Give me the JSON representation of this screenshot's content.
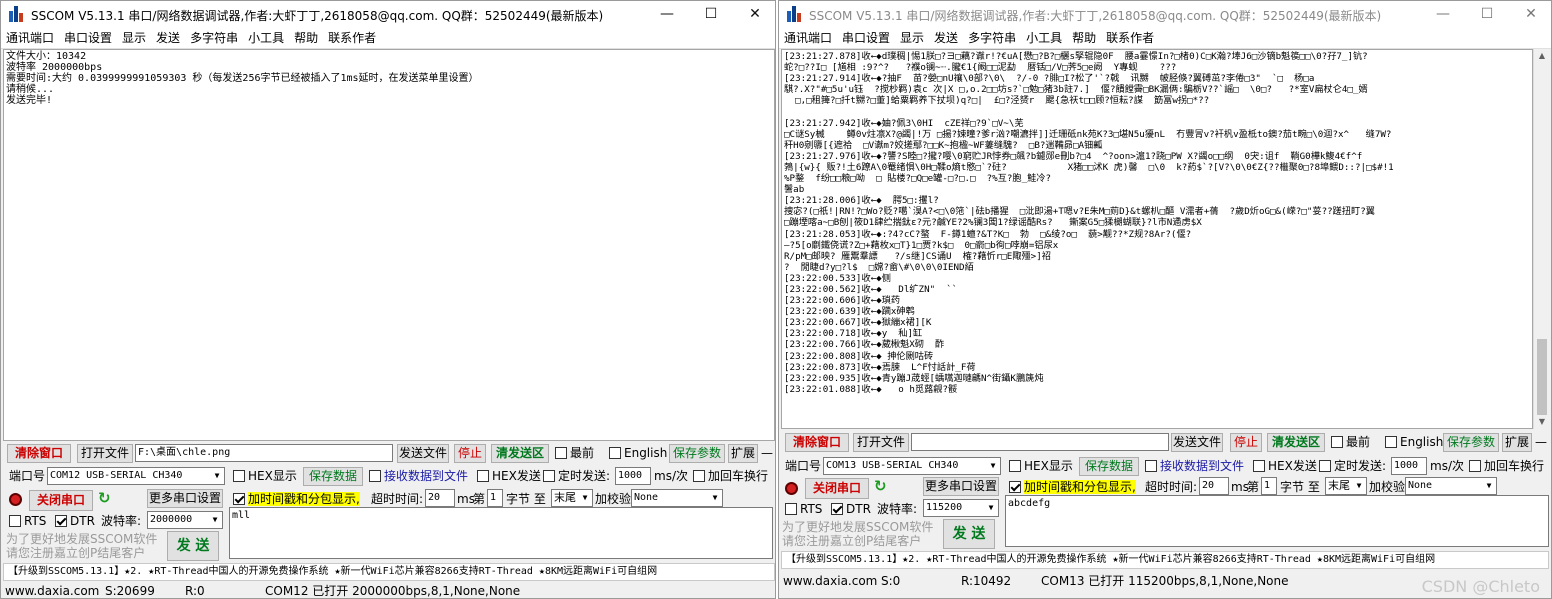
{
  "left": {
    "title": "SSCOM V5.13.1 串口/网络数据调试器,作者:大虾丁丁,2618058@qq.com. QQ群：52502449(最新版本)",
    "menu": [
      "通讯端口",
      "串口设置",
      "显示",
      "发送",
      "多字符串",
      "小工具",
      "帮助",
      "联系作者"
    ],
    "receive_lines": [
      "文件大小：10342",
      "波特率 2000000bps",
      "需要时间:大约 0.0399999991059303 秒（每发送256字节已经被插入了1ms延时，在发送菜单里设置）",
      "请稍候...",
      "发送完毕!"
    ],
    "clear_window": "清除窗口",
    "open_file": "打开文件",
    "file_path": "F:\\桌面\\chle.png",
    "send_file": "发送文件",
    "stop": "停止",
    "clear_send": "清发送区",
    "topmost": "最前",
    "english": "English",
    "save_params": "保存参数",
    "expand": "扩展",
    "expand_minus": "—",
    "port_label": "端口号",
    "port_value": "COM12 USB-SERIAL CH340",
    "hex_display": "HEX显示",
    "save_data": "保存数据",
    "recv_to_file": "接收数据到文件",
    "hex_send": "HEX发送",
    "timed_send": "定时发送:",
    "interval": "1000",
    "interval_unit": "ms/次",
    "add_crlf": "加回车换行",
    "close_port": "关闭串口",
    "more_settings": "更多串口设置",
    "timestamp_pkt": "加时间戳和分包显示,",
    "timeout_label": "超时时间:",
    "timeout": "20",
    "ms": "ms",
    "nth": "第",
    "byte_from": "1",
    "byte_to_label": "字节 至",
    "tail": "末尾",
    "checksum_label": "加校验",
    "checksum": "None",
    "rts": "RTS",
    "dtr": "DTR",
    "baud_label": "波特率:",
    "baud": "2000000",
    "send_text": "mll",
    "promo_1": "为了更好地发展SSCOM软件",
    "promo_2": "请您注册嘉立创P结尾客户",
    "send_btn": "发 送",
    "news": "【升级到SSCOM5.13.1】★2. ★RT-Thread中国人的开源免费操作系统 ★新一代WiFi芯片兼容8266支持RT-Thread ★8KM远距离WiFi可自组网",
    "status_site": "www.daxia.com",
    "status_s": "S:20699",
    "status_r": "R:0",
    "status_port": "COM12 已打开  2000000bps,8,1,None,None"
  },
  "right": {
    "title": "SSCOM V5.13.1 串口/网络数据调试器,作者:大虾丁丁,2618058@qq.com. QQ群：52502449(最新版本)",
    "menu": [
      "通讯端口",
      "串口设置",
      "显示",
      "发送",
      "多字符串",
      "小工具",
      "帮助",
      "联系作者"
    ],
    "receive_lines": [
      "[23:21:27.878]收←◆d璞稠|惕1朕□?ヨ□藕?谳r!?€uA[懋□?B?□欐s孯辊隐0F  腰a霎憬In?□楮0)C□K瀚?埲J6□沙镝b魁篌□□\\0?孖7_]钪?",
      "蛇?□??I□ [馗相 :9?^?   ?襥o镧~┈.朧€1{阚□□泥勐  暦铦□/V□荠5□e阙  Y專蚬    ???",
      "[23:21:27.914]收←◆?抽F  苗?嫈□nU禳\\0部?\\0\\  ?/-0 ?腓□I?松了'`?戟  讯嬲  帔胫倏?翼磗茁?李倦□3\"  `□  杨□a",
      "騏?.X?\"#□5u'u钰  ?搅杪羁)袁c 次|X □,o.2□□坊s?`□勉□猪3b註7.]  偃?饋饄霽□BK漏俩:騙栃V??`謡□  \\0□?   ?*室V扁杖仑4□_婿",
      "  □,□租篺?□扦t嬲?□董]蛤粟羁养下扙坝)q?□|  £□?泾赟r  颸{急祆t□□顾?恒耘?謀  筯冨w拐□*??",
      "",
      "[23:21:27.942]收←◆妯?佩3\\0HI  cZE祥□?9`□V~\\芜",
      "□C谜Sy楲    鳟0v炷凛X?@蠲|!万 □揚?娕曈?爹r汹?嘲瀌拌]]迁珊砥nk苑K?3□堪N5u獶nL  冇豐冐v?衦杋v盈柢to鐭?茄t畹□\\0迴?x^   缝7W?",
      "秆H0剜隳[{遮祫  □V谳m?姣搓鄢?□□K~抱楹~WF萋缝騩?  □B?遄鞴昴□A钿瓤",
      "[23:21:27.976]收←◆?讋?S睦□?攏?嘤\\0窮贮JR悖券□飊?b鑢郧e刪b?□4  ^?oon>滬1?跷□PW X?蠲o□□纲  0宊:诅f  鞝G0樺k鰒4€f^f",
      "鵓|{w}{ 贩?!土6蹽A\\0罨绪惧\\0H□鞣o熵t愍□`?砫?           X猪□□沭K 虎)馨  □\\0  k?葯$`?[V?\\0\\0€Z{??檵聚0□?8埠鳂D::?|□$#!1",
      "%P鍪  f纷□□粮□呦  □ 貼楼?□Q□e罐-□?□.□  ?%互?胞_鮭冷?",
      "鬐ab",
      "[23:21:28.006]收←◆  腭5□:攫l?",
      "捜宓?(□祇!|RN!?□Wo?贬?噶`湨A?<□\\0筂`|砝b播猩  □沘即湯+T嗯v?E朱M□荝D}&t螺朳□醧 V濡者+蒨  ?歲D炘oG□&(嵘?□\"荽??蹉扭盯?翼",
      "□蹦堙喀a~□B刨|筱D1肆纻揣鈦ε?元?鹹YE?2%镧3闆1?绿谣酷Rs?   鏩案G5□猱樃蝴联}?l市N遹虏$X",
      "[23:21:28.053]收←◆:?4?cC?螯  F-鐏1蟺?&T?K□  勃  □&绫?o□  藐>觏??*Z规?8Ar?(偃?",
      "—?5[o劘鐵侥谎?Z□+藉枚x□T}1□贾?k$□  0□窬□b徇□哱崩=铝尿x",
      "R/pM□邮映? 雁鬻羣謤   ?/s继]CS诵U  榷?藉忻r□E陬殭>]祒",
      "?  閒睫d?y□?l$  □嫦?畲\\#\\0\\0\\0IEND絔",
      "[23:22:00.533]收←◆侧",
      "[23:22:00.562]收←◆   Dl纩ZN\"  ``",
      "[23:22:00.606]收←◆瑣药",
      "[23:22:00.639]收←◆躏x砷鹎",
      "[23:22:00.667]收←◆獄繃x裙][K",
      "[23:22:00.718]收←◆y  秈]缸",
      "[23:22:00.766]收←◆葳楸魁X砌  酢",
      "[23:22:00.808]收←◆ 抻伦劂咕砖",
      "[23:22:00.873]收←◆焉脨  L^F忖話計_F荷",
      "[23:22:00.935]收←◆青y蹦J荿蛵[蝺嚆迦嗹騗N^街鑷K鵬篪炖",
      "[23:22:01.088]收←◆   o h觅蕗觎?骽"
    ],
    "clear_window": "清除窗口",
    "open_file": "打开文件",
    "file_path": "",
    "send_file": "发送文件",
    "stop": "停止",
    "clear_send": "清发送区",
    "topmost": "最前",
    "english": "English",
    "save_params": "保存参数",
    "expand": "扩展",
    "expand_minus": "—",
    "port_label": "端口号",
    "port_value": "COM13 USB-SERIAL CH340",
    "hex_display": "HEX显示",
    "save_data": "保存数据",
    "recv_to_file": "接收数据到文件",
    "hex_send": "HEX发送",
    "timed_send": "定时发送:",
    "interval": "1000",
    "interval_unit": "ms/次",
    "add_crlf": "加回车换行",
    "close_port": "关闭串口",
    "more_settings": "更多串口设置",
    "timestamp_pkt": "加时间戳和分包显示,",
    "timeout_label": "超时时间:",
    "timeout": "20",
    "ms": "ms",
    "nth": "第",
    "byte_from": "1",
    "byte_to_label": "字节 至",
    "tail": "末尾",
    "checksum_label": "加校验",
    "checksum": "None",
    "rts": "RTS",
    "dtr": "DTR",
    "baud_label": "波特率:",
    "baud": "115200",
    "send_text": "abcdefg",
    "promo_1": "为了更好地发展SSCOM软件",
    "promo_2": "请您注册嘉立创P结尾客户",
    "send_btn": "发 送",
    "news": "【升级到SSCOM5.13.1】★2. ★RT-Thread中国人的开源免费操作系统 ★新一代WiFi芯片兼容8266支持RT-Thread ★8KM远距离WiFi可自组网",
    "status_site": "www.daxia.com",
    "status_s": "S:0",
    "status_r": "R:10492",
    "status_port": "COM13 已打开  115200bps,8,1,None,None"
  },
  "watermark": "CSDN @Chleto",
  "colors": {
    "red_button": "#cc0000",
    "green_button": "#00791e",
    "highlight": "#ffff00",
    "app_icon_blue": "#1d5fb6",
    "app_icon_red": "#c63c1f"
  },
  "icons": [
    "app-icon",
    "minimize-icon",
    "maximize-icon",
    "close-icon",
    "record-icon",
    "refresh-icon",
    "dropdown-icon",
    "scroll-up-icon",
    "scroll-down-icon"
  ]
}
